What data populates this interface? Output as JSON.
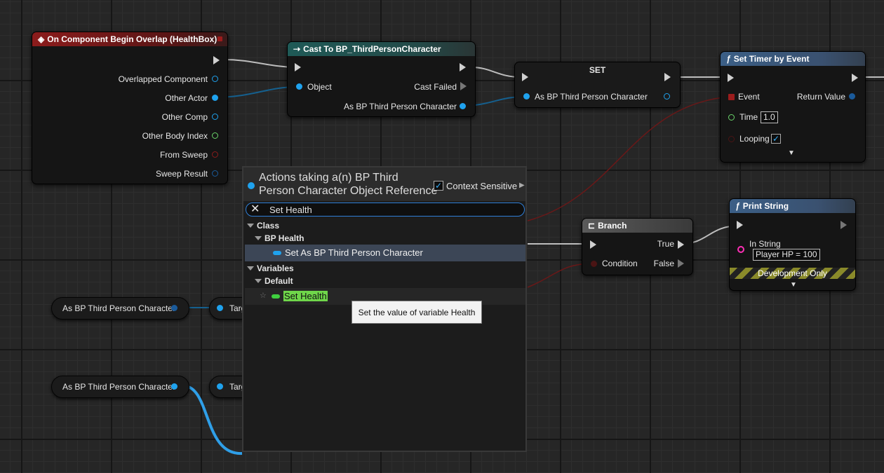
{
  "nodes": {
    "overlap": {
      "title": "On Component Begin Overlap (HealthBox)",
      "pins": [
        "Overlapped Component",
        "Other Actor",
        "Other Comp",
        "Other Body Index",
        "From Sweep",
        "Sweep Result"
      ]
    },
    "cast": {
      "title": "Cast To BP_ThirdPersonCharacter",
      "object": "Object",
      "cast_failed": "Cast Failed",
      "as_out": "As BP Third Person Character"
    },
    "set": {
      "title": "SET",
      "pin": "As BP Third Person Character"
    },
    "timer": {
      "title": "Set Timer by Event",
      "event": "Event",
      "return": "Return Value",
      "time_label": "Time",
      "time_value": "1.0",
      "looping": "Looping"
    },
    "branch": {
      "title": "Branch",
      "true": "True",
      "condition": "Condition",
      "false": "False"
    },
    "print": {
      "title": "Print String",
      "in_string": "In String",
      "in_string_value": "Player HP = 100",
      "dev_only": "Development Only"
    },
    "var1": {
      "label": "As BP Third Person Character",
      "target": "Targ"
    },
    "var2": {
      "label": "As BP Third Person Character",
      "target": "Targ"
    }
  },
  "menu": {
    "heading_line1": "Actions taking a(n) BP Third",
    "heading_line2": "Person Character Object Reference",
    "context_sensitive": "Context Sensitive",
    "search_value": "Set Health",
    "tree": {
      "class": "Class",
      "bp_health": "BP Health",
      "set_as": "Set As BP Third Person Character",
      "variables": "Variables",
      "default": "Default",
      "set_health": "Set Health"
    }
  },
  "tooltip": "Set the value of variable Health",
  "colors": {
    "object_pin": "#1fa2ee",
    "bool_pin": "#8a1c1c",
    "string_pin": "#ff2fb6",
    "highlight": "#6fd64a"
  }
}
